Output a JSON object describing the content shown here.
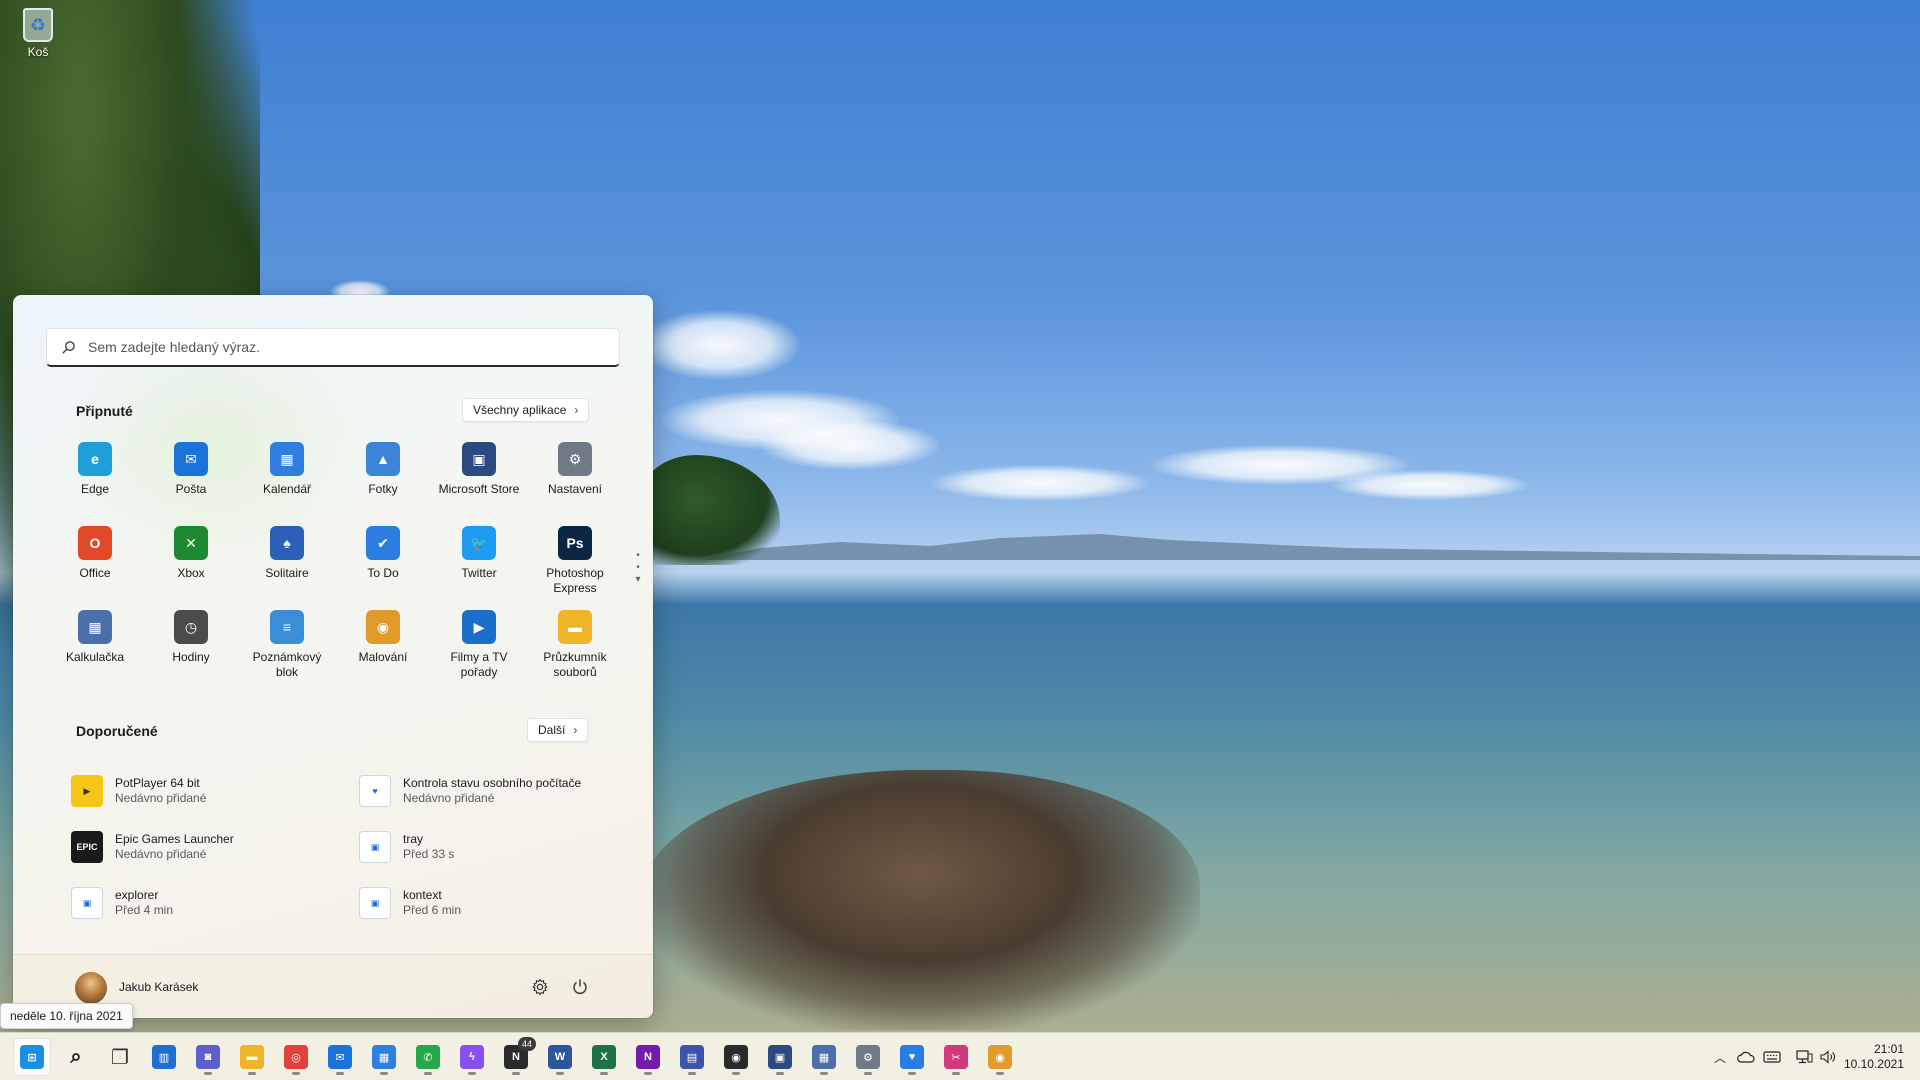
{
  "desktop": {
    "recycle_bin_label": "Koš"
  },
  "start_menu": {
    "search_placeholder": "Sem zadejte hledaný výraz.",
    "pinned_title": "Připnuté",
    "all_apps_label": "Všechny aplikace",
    "pinned_apps": [
      {
        "label": "Edge",
        "icon": "edge-icon",
        "color": "#1f9fd8"
      },
      {
        "label": "Pošta",
        "icon": "mail-icon",
        "color": "#1a73d9"
      },
      {
        "label": "Kalendář",
        "icon": "calendar-icon",
        "color": "#2f7fe0"
      },
      {
        "label": "Fotky",
        "icon": "photos-icon",
        "color": "#3b84d6"
      },
      {
        "label": "Microsoft Store",
        "icon": "store-icon",
        "color": "#2b4a7f"
      },
      {
        "label": "Nastavení",
        "icon": "settings-icon",
        "color": "#6f7a86"
      },
      {
        "label": "Office",
        "icon": "office-icon",
        "color": "#e2482a"
      },
      {
        "label": "Xbox",
        "icon": "xbox-icon",
        "color": "#1d8a33"
      },
      {
        "label": "Solitaire",
        "icon": "solitaire-icon",
        "color": "#2b5fb8"
      },
      {
        "label": "To Do",
        "icon": "todo-icon",
        "color": "#2c7de0"
      },
      {
        "label": "Twitter",
        "icon": "twitter-icon",
        "color": "#1d9bf0"
      },
      {
        "label": "Photoshop Express",
        "icon": "photoshop-icon",
        "color": "#0b2640"
      },
      {
        "label": "Kalkulačka",
        "icon": "calculator-icon",
        "color": "#4b6fa8"
      },
      {
        "label": "Hodiny",
        "icon": "clock-icon",
        "color": "#4b4b4b"
      },
      {
        "label": "Poznámkový blok",
        "icon": "notepad-icon",
        "color": "#3a8ed8"
      },
      {
        "label": "Malování",
        "icon": "paint-icon",
        "color": "#e29a2a"
      },
      {
        "label": "Filmy a TV pořady",
        "icon": "movies-icon",
        "color": "#1c6fc8"
      },
      {
        "label": "Průzkumník souborů",
        "icon": "folder-icon",
        "color": "#f0b429"
      }
    ],
    "recommended_title": "Doporučené",
    "more_label": "Další",
    "recommended": [
      {
        "title": "PotPlayer 64 bit",
        "subtitle": "Nedávno přidané",
        "icon": "potplayer-icon",
        "color": "#f5c518",
        "glyph": "▶"
      },
      {
        "title": "Kontrola stavu osobního počítače",
        "subtitle": "Nedávno přidané",
        "icon": "health-check-icon",
        "color": "#ffffff",
        "glyph": "♥"
      },
      {
        "title": "Epic Games Launcher",
        "subtitle": "Nedávno přidané",
        "icon": "epic-games-icon",
        "color": "#1a1a1a",
        "glyph": "EPIC"
      },
      {
        "title": "tray",
        "subtitle": "Před 33 s",
        "icon": "image-file-icon",
        "color": "#ffffff",
        "glyph": "▣"
      },
      {
        "title": "explorer",
        "subtitle": "Před 4 min",
        "icon": "image-file-icon",
        "color": "#ffffff",
        "glyph": "▣"
      },
      {
        "title": "kontext",
        "subtitle": "Před 6 min",
        "icon": "image-file-icon",
        "color": "#ffffff",
        "glyph": "▣"
      }
    ],
    "user_name": "Jakub Karásek"
  },
  "tooltip": {
    "date_text": "neděle 10. října 2021"
  },
  "taskbar": {
    "apps": [
      {
        "name": "start-button",
        "icon": "windows-logo-icon",
        "color": "#1b8fe0",
        "active": true
      },
      {
        "name": "search-button",
        "icon": "search-icon",
        "color": "#222222",
        "active": false
      },
      {
        "name": "task-view-button",
        "icon": "task-view-icon",
        "color": "#333333",
        "active": false
      },
      {
        "name": "widgets-button",
        "icon": "widgets-icon",
        "color": "#1f6fd1",
        "active": false
      },
      {
        "name": "teams-chat-button",
        "icon": "chat-icon",
        "color": "#5b5fc7",
        "active": false
      },
      {
        "name": "file-explorer-button",
        "icon": "folder-icon",
        "color": "#f0b429",
        "active": false
      },
      {
        "name": "chrome-button",
        "icon": "chrome-icon",
        "color": "#e0413a",
        "active": false
      },
      {
        "name": "mail-button",
        "icon": "mail-icon",
        "color": "#1a73d9",
        "active": false
      },
      {
        "name": "calendar-button",
        "icon": "calendar-icon",
        "color": "#2f7fe0",
        "active": false
      },
      {
        "name": "whatsapp-button",
        "icon": "whatsapp-icon",
        "color": "#26a84a",
        "active": false
      },
      {
        "name": "messenger-button",
        "icon": "messenger-icon",
        "color": "#8a4ff0",
        "active": false
      },
      {
        "name": "news-button",
        "icon": "news-icon",
        "color": "#2a2a2a",
        "active": false,
        "badge": "44"
      },
      {
        "name": "word-button",
        "icon": "word-icon",
        "color": "#2b579a",
        "active": false
      },
      {
        "name": "excel-button",
        "icon": "excel-icon",
        "color": "#1e7145",
        "active": false
      },
      {
        "name": "onenote-button",
        "icon": "onenote-icon",
        "color": "#7719aa",
        "active": false
      },
      {
        "name": "save-app-button",
        "icon": "floppy-icon",
        "color": "#3d55a8",
        "active": false
      },
      {
        "name": "media-player-button",
        "icon": "media-disc-icon",
        "color": "#2a2a2a",
        "active": false
      },
      {
        "name": "store-button",
        "icon": "store-icon",
        "color": "#2b4a7f",
        "active": false
      },
      {
        "name": "calculator-button",
        "icon": "calculator-icon",
        "color": "#4b6fa8",
        "active": false
      },
      {
        "name": "settings-button",
        "icon": "settings-icon",
        "color": "#6f7a86",
        "active": false
      },
      {
        "name": "pc-health-button",
        "icon": "health-check-icon",
        "color": "#2a7de0",
        "active": false
      },
      {
        "name": "snipping-tool-button",
        "icon": "snipping-icon",
        "color": "#d13a7a",
        "active": false
      },
      {
        "name": "paint-button",
        "icon": "paint-icon",
        "color": "#e29a2a",
        "active": false
      }
    ],
    "tray": {
      "time": "21:01",
      "date": "10.10.2021"
    }
  }
}
